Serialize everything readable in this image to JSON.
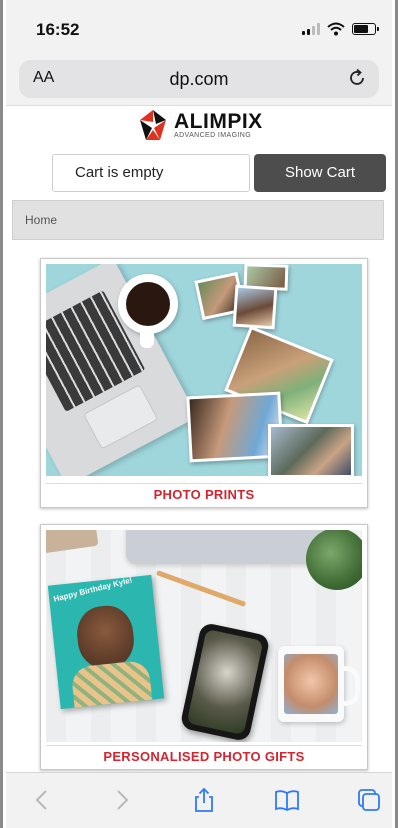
{
  "status_bar": {
    "time": "16:52"
  },
  "url_bar": {
    "text_size_label": "AA",
    "url": "dp.com"
  },
  "logo": {
    "name": "ALIMPIX",
    "tagline": "ADVANCED IMAGING"
  },
  "cart": {
    "status": "Cart is empty",
    "show_cart_label": "Show Cart"
  },
  "breadcrumb": {
    "items": [
      "Home"
    ]
  },
  "categories": [
    {
      "caption": "PHOTO PRINTS"
    },
    {
      "caption": "PERSONALISED PHOTO GIFTS",
      "image_text": "Happy Birthday Kyle!"
    }
  ],
  "colors": {
    "accent_red": "#d42430",
    "button_dark": "#4d4d4d",
    "breadcrumb_bg": "#e1e1e1",
    "ios_blue": "#2f7bf6"
  },
  "toolbar": {
    "icons": [
      "back-arrow-icon",
      "forward-arrow-icon",
      "share-icon",
      "bookmarks-icon",
      "tabs-icon"
    ]
  }
}
